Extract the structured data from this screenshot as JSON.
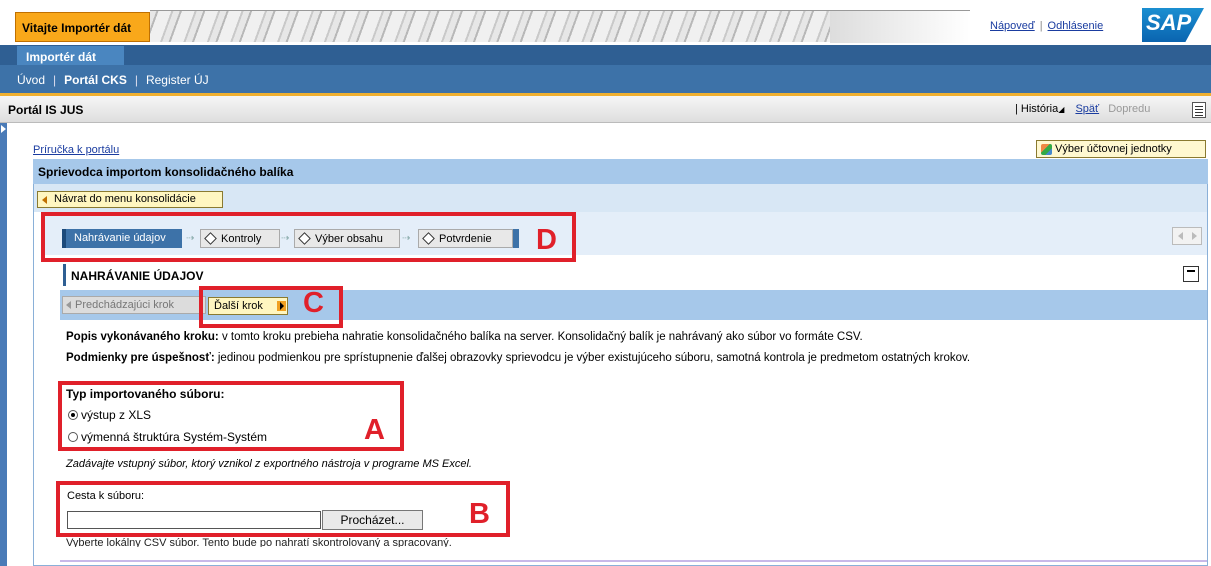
{
  "banner": {
    "title": "Vitajte Importér dát",
    "help_link": "Nápoveď",
    "logout_link": "Odhlásenie",
    "logo": "SAP"
  },
  "nav": {
    "active_tab": "Importér dát",
    "links": [
      "Úvod",
      "Portál CKS",
      "Register ÚJ"
    ]
  },
  "portal": {
    "title": "Portál IS JUS",
    "history": "História",
    "back": "Späť",
    "forward": "Dopredu"
  },
  "content": {
    "guide_link": "Príručka k portálu",
    "unit_button": "Výber účtovnej jednotky",
    "wizard_title": "Sprievodca importom konsolidačného balíka",
    "back_button": "Návrat do menu konsolidácie"
  },
  "steps": [
    {
      "label": "Nahrávanie údajov",
      "active": true
    },
    {
      "label": "Kontroly",
      "active": false
    },
    {
      "label": "Výber obsahu",
      "active": false
    },
    {
      "label": "Potvrdenie",
      "active": false
    }
  ],
  "section": {
    "title": "NAHRÁVANIE ÚDAJOV",
    "prev_button": "Predchádzajúci krok",
    "next_button": "Ďalší krok"
  },
  "description": {
    "step_label": "Popis vykonávaného kroku:",
    "step_text": "v tomto kroku prebieha nahratie konsolidačného balíka na server. Konsolidačný balík je nahrávaný ako súbor vo formáte CSV.",
    "cond_label": "Podmienky pre úspešnosť:",
    "cond_text": "jedinou podmienkou pre sprístupnenie ďalšej obrazovky sprievodcu je výber existujúceho súboru, samotná kontrola je predmetom ostatných krokov."
  },
  "file_type": {
    "title": "Typ importovaného súboru:",
    "options": [
      {
        "label": "výstup z XLS",
        "selected": true
      },
      {
        "label": "výmenná štruktúra Systém-Systém",
        "selected": false
      }
    ],
    "hint": "Zadávajte vstupný súbor, ktorý vznikol z exportného nástroja v programe MS Excel."
  },
  "file_path": {
    "label": "Cesta k súboru:",
    "value": "",
    "browse_button": "Procházet...",
    "hint": "Vyberte lokálny CSV súbor. Tento bude po nahratí skontrolovaný a spracovaný."
  },
  "annotations": [
    "A",
    "B",
    "C",
    "D"
  ],
  "colors": {
    "annotation": "#e0202a",
    "nav_blue": "#3d72a8",
    "banner_orange": "#f9a81a"
  }
}
